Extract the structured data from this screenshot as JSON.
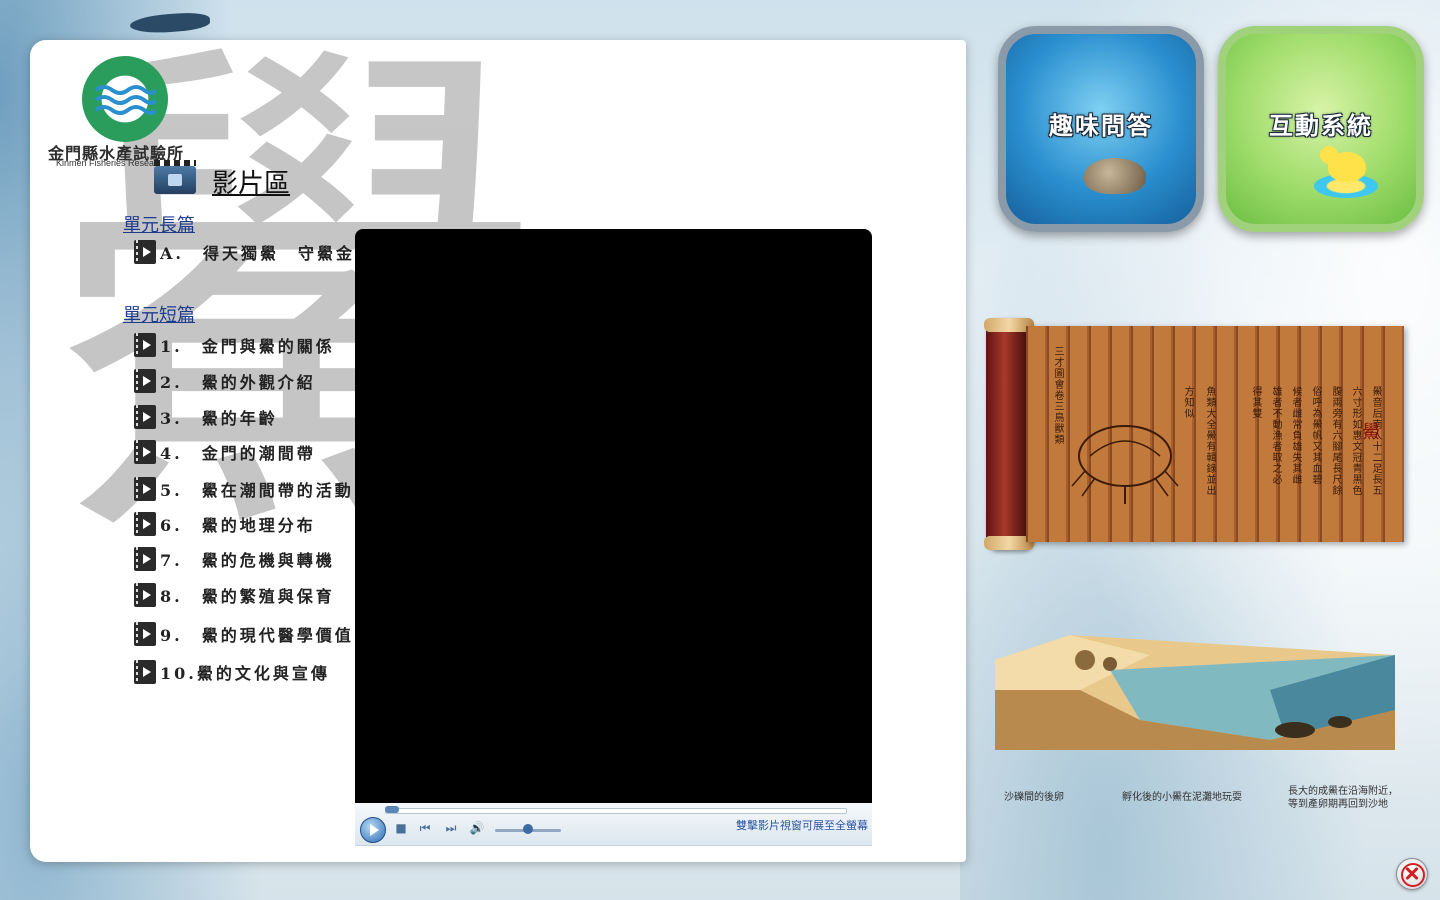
{
  "logo": {
    "title": "金門縣水產試驗所",
    "subtitle": "Kinmen Fisheries Research",
    "ring_text": "KINMEN F.R.I."
  },
  "watermark_glyph": "鱟",
  "section": {
    "title": "影片區",
    "icon": "video-camera-icon"
  },
  "long_group": {
    "heading": "單元長篇",
    "items": [
      {
        "label": "A.　得天獨鱟　守鱟金門"
      }
    ]
  },
  "short_group": {
    "heading": "單元短篇",
    "items": [
      {
        "label": "1.　金門與鱟的關係"
      },
      {
        "label": "2.　鱟的外觀介紹"
      },
      {
        "label": "3.　鱟的年齡"
      },
      {
        "label": "4.　金門的潮間帶"
      },
      {
        "label": "5.　鱟在潮間帶的活動"
      },
      {
        "label": "6.　鱟的地理分布"
      },
      {
        "label": "7.　鱟的危機與轉機"
      },
      {
        "label": "8.　鱟的繁殖與保育"
      },
      {
        "label": "9.　鱟的現代醫學價值"
      },
      {
        "label": "10.鱟的文化與宣傳"
      }
    ]
  },
  "player": {
    "hint": "雙擊影片視窗可展至全螢幕",
    "progress": 0,
    "volume": 0.5,
    "icons": [
      "play-icon",
      "stop-icon",
      "previous-icon",
      "next-icon",
      "volume-icon"
    ]
  },
  "buttons": {
    "quiz_label": "趣味問答",
    "system_label": "互動系統"
  },
  "scroll": {
    "title": "鱟",
    "columns": [
      "鱟音后南人十二足長五",
      "六寸形如惠文冠青黑色",
      "腹兩旁有六腳尾長尺餘",
      "俗呼為鱟帆又其血碧",
      "候者雌常負雄失其雌",
      "雄者不動漁者取之必",
      "得其雙",
      "魚類大全鱟有輯錄並出",
      "方知似",
      "三才圖會卷三鳥獸類"
    ]
  },
  "diagram": {
    "labels": [
      "沙礫間的後卵",
      "孵化後的小鱟在泥灘地玩耍",
      "長大的成鱟在沿海附近，",
      "等到產卵期再回到沙地"
    ]
  },
  "colors": {
    "heading_blue": "#1d3c8f",
    "hint_blue": "#2c55a2",
    "close_red": "#d21f1f"
  }
}
